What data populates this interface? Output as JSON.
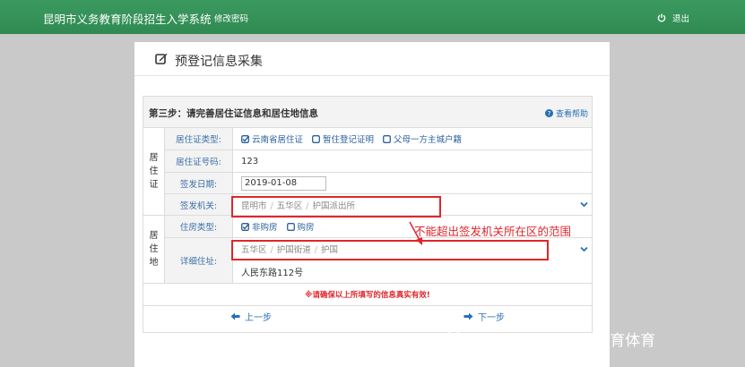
{
  "header": {
    "system_title": "昆明市义务教育阶段招生入学系统",
    "change_password": "修改密码",
    "logout": "退出"
  },
  "page": {
    "title": "预登记信息采集"
  },
  "step": {
    "title": "第三步：请完善居住证信息和居住地信息",
    "help": "查看帮助"
  },
  "residence_permit": {
    "group_label": [
      "居",
      "住",
      "证"
    ],
    "type_label": "居住证类型:",
    "type_options": [
      "云南省居住证",
      "暂住登记证明",
      "父母一方主城户籍"
    ],
    "number_label": "居住证号码:",
    "number_value": "123",
    "issue_date_label": "签发日期:",
    "issue_date_value": "2019-01-08",
    "issuer_label": "签发机关:",
    "issuer_path": [
      "昆明市",
      "五华区",
      "护国派出所"
    ]
  },
  "residence": {
    "group_label": [
      "居",
      "住",
      "地"
    ],
    "housing_label": "住房类型:",
    "housing_options": [
      "非购房",
      "购房"
    ],
    "address_label": "详细住址:",
    "address_path": [
      "五华区",
      "护国街道",
      "护国"
    ],
    "address_detail": "人民东路112号"
  },
  "annotation": {
    "text": "不能超出签发机关所在区的范围",
    "color": "#e0262b"
  },
  "notice": "※请确保以上所填写的信息真实有效!",
  "nav": {
    "prev": "上一步",
    "next": "下一步"
  },
  "watermark": "公众号 · 昆明西山教育体育",
  "colors": {
    "header_green": "#2f8a52",
    "link_blue": "#2a6fb5",
    "alert_red": "#e0262b"
  }
}
